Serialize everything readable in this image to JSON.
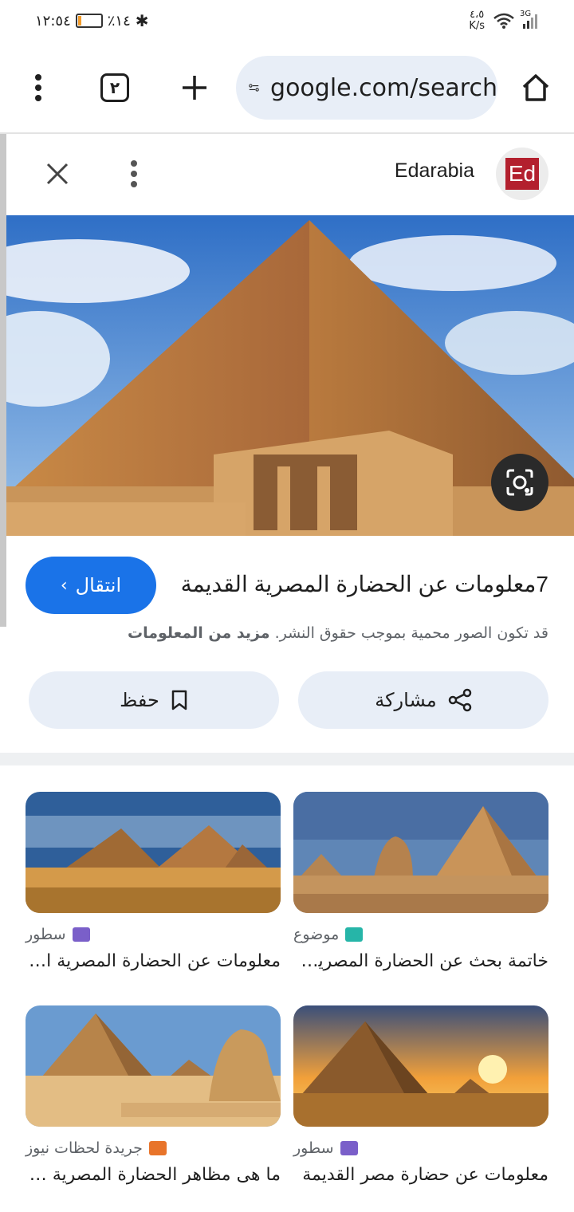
{
  "status_bar": {
    "time": "١٢:٥٤",
    "battery": "٪١٤",
    "battery_level": 0.14,
    "speed_value": "٤،٥",
    "speed_unit": "K/s",
    "network": "3G"
  },
  "toolbar": {
    "tab_count": "٢",
    "url": "google.com/search"
  },
  "source": {
    "name": "Edarabia",
    "logo_text": "Ed"
  },
  "image_panel": {
    "goto_label": "انتقال",
    "title": "7معلومات عن الحضارة المصرية القديمة",
    "copyright_text": "قد تكون الصور محمية بموجب حقوق النشر. ",
    "more_info": "مزيد من المعلومات",
    "share_label": "مشاركة",
    "save_label": "حفظ"
  },
  "related": [
    {
      "source": "موضوع",
      "title": "خاتمة بحث عن الحضارة المصرية القديمة",
      "favicon_color": "#26b5a8"
    },
    {
      "source": "سطور",
      "title": "معلومات عن الحضارة المصرية القديمة",
      "favicon_color": "#7a5fc9"
    },
    {
      "source": "سطور",
      "title": "معلومات عن حضارة مصر القديمة",
      "favicon_color": "#7a5fc9"
    },
    {
      "source": "جريدة لحظات نيوز",
      "title": "ما هى مظاهر الحضارة المصرية القديمة",
      "favicon_color": "#e8742a"
    }
  ],
  "colors": {
    "accent": "#1a73e8",
    "pill_bg": "#e8eef7"
  }
}
